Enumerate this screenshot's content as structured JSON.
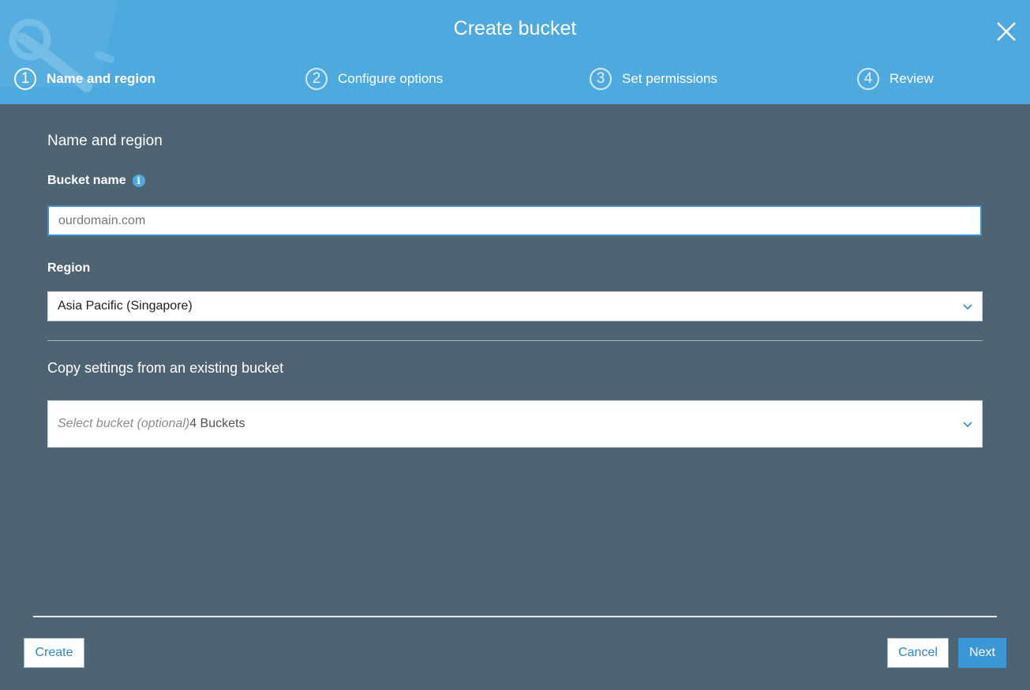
{
  "header": {
    "title": "Create bucket",
    "close_icon": "close-icon"
  },
  "steps": [
    {
      "number": "1",
      "label": "Name and region",
      "active": true
    },
    {
      "number": "2",
      "label": "Configure options",
      "active": false
    },
    {
      "number": "3",
      "label": "Set permissions",
      "active": false
    },
    {
      "number": "4",
      "label": "Review",
      "active": false
    }
  ],
  "form": {
    "section_title": "Name and region",
    "bucket_name_label": "Bucket name",
    "bucket_name_value": "ourdomain.com",
    "region_label": "Region",
    "region_value": "Asia Pacific (Singapore)",
    "copy_title": "Copy settings from an existing bucket",
    "copy_placeholder": "Select bucket (optional)",
    "copy_count": "4 Buckets"
  },
  "footer": {
    "create_label": "Create",
    "cancel_label": "Cancel",
    "next_label": "Next"
  },
  "colors": {
    "header_bg": "#4ea9de",
    "body_bg": "#4f6472",
    "accent": "#3a96d5"
  }
}
